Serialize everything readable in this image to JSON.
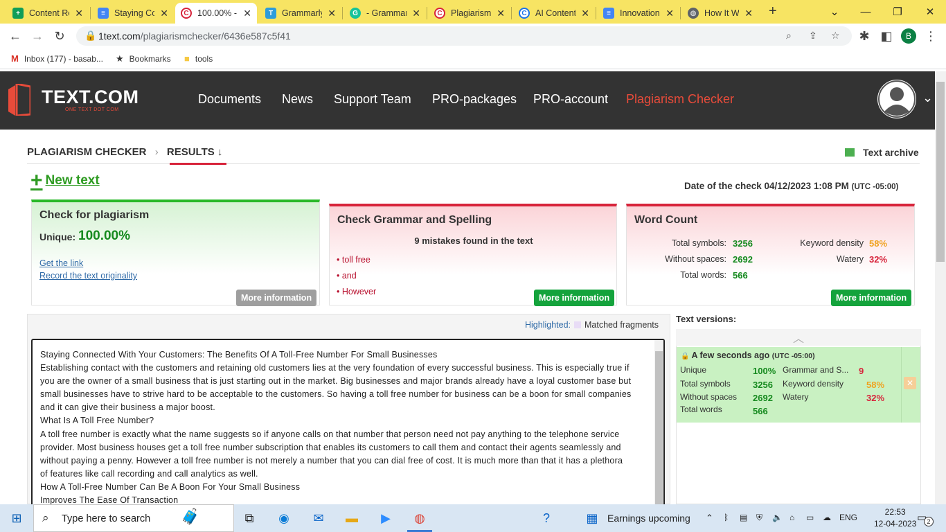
{
  "browser": {
    "tabs": [
      {
        "title": "Content Re",
        "favicon": "sheets-icon",
        "color": "#0f9d58"
      },
      {
        "title": "Staying Co",
        "favicon": "docs-icon",
        "color": "#4285f4"
      },
      {
        "title": "100.00% -",
        "favicon": "copyright-icon",
        "color": "#d7243b"
      },
      {
        "title": "Grammarly",
        "favicon": "t-icon",
        "color": "#2d9cdb"
      },
      {
        "title": "- Grammar",
        "favicon": "grammarly-icon",
        "color": "#15c39a"
      },
      {
        "title": "Plagiarism",
        "favicon": "copyright-icon",
        "color": "#d7243b"
      },
      {
        "title": "AI Content",
        "favicon": "c-icon",
        "color": "#1a73e8"
      },
      {
        "title": "Innovation",
        "favicon": "docs-icon",
        "color": "#4285f4"
      },
      {
        "title": "How It Wo",
        "favicon": "globe-icon",
        "color": "#5f6368"
      }
    ],
    "url_host": "1text.com",
    "url_path": "/plagiarismchecker/6436e587c5f41",
    "profile_initial": "B",
    "bookmarks": [
      {
        "label": "Inbox (177) - basab...",
        "icon": "gmail-icon"
      },
      {
        "label": "Bookmarks",
        "icon": "star-icon"
      },
      {
        "label": "tools",
        "icon": "folder-icon"
      }
    ]
  },
  "site": {
    "logo_text": "TEXT.COM",
    "logo_sub": "ONE TEXT DOT COM",
    "nav": [
      "Documents",
      "News",
      "Support Team",
      "PRO-packages",
      "PRO-account",
      "Plagiarism Checker"
    ]
  },
  "breadcrumb": {
    "root": "PLAGIARISM CHECKER",
    "current": "RESULTS ↓"
  },
  "archive_label": "Text archive",
  "new_text_label": "New text",
  "check_date": {
    "label": "Date of the check 04/12/2023 1:08 PM",
    "tz": "(UTC -05:00)"
  },
  "plagiarism_card": {
    "title": "Check for plagiarism",
    "unique_label": "Unique:",
    "unique_value": "100.00%",
    "link1": "Get the link",
    "link2": "Record the text originality",
    "button": "More information"
  },
  "grammar_card": {
    "title": "Check Grammar and Spelling",
    "summary": "9 mistakes found in the text",
    "mistakes": [
      "• toll free",
      "• and",
      "• However"
    ],
    "button": "More information"
  },
  "word_card": {
    "title": "Word Count",
    "total_symbols_label": "Total symbols:",
    "total_symbols": "3256",
    "without_spaces_label": "Without spaces:",
    "without_spaces": "2692",
    "total_words_label": "Total words:",
    "total_words": "566",
    "keyword_density_label": "Keyword density",
    "keyword_density": "58%",
    "watery_label": "Watery",
    "watery": "32%",
    "button": "More information"
  },
  "legend": {
    "highlighted": "Highlighted:",
    "matched": "Matched fragments"
  },
  "text_lines": [
    "Staying Connected With Your Customers: The Benefits Of A Toll-Free Number For Small Businesses",
    "Establishing contact with the customers and retaining old customers lies at the very foundation of every successful business. This is especially true if",
    "you are the owner of a small business that is just starting out in the market. Big businesses and major brands already have a loyal customer base but",
    "small businesses have to strive hard to be acceptable to the customers. So having a toll free number for business can be a boon for small companies",
    "and it can give their business a major boost.",
    "What Is A Toll Free Number?",
    "A toll free number is exactly what the name suggests so if anyone calls on that number that person need not pay anything to the telephone service",
    "provider. Most business houses get a toll free number subscription that enables its customers to call them and contact their agents seamlessly and",
    "without paying a penny. However a toll free number is not merely a number that you can dial free of cost. It is much more than that it has a plethora",
    "of features like call recording and call analytics as well.",
    "How A Toll-Free Number Can Be A Boon For Your Small Business",
    "Improves The Ease Of Transaction"
  ],
  "versions": {
    "title": "Text versions:",
    "item": {
      "time": "A few seconds ago",
      "tz": "(UTC -05:00)",
      "unique_label": "Unique",
      "unique": "100%",
      "grammar_label": "Grammar and S...",
      "grammar": "9",
      "total_symbols_label": "Total symbols",
      "total_symbols": "3256",
      "keyword_label": "Keyword density",
      "keyword": "58%",
      "without_spaces_label": "Without spaces",
      "without_spaces": "2692",
      "watery_label": "Watery",
      "watery": "32%",
      "total_words_label": "Total words",
      "total_words": "566"
    }
  },
  "taskbar": {
    "search_placeholder": "Type here to search",
    "news": "Earnings upcoming",
    "lang": "ENG",
    "time": "22:53",
    "date": "12-04-2023",
    "notifications": "2"
  }
}
